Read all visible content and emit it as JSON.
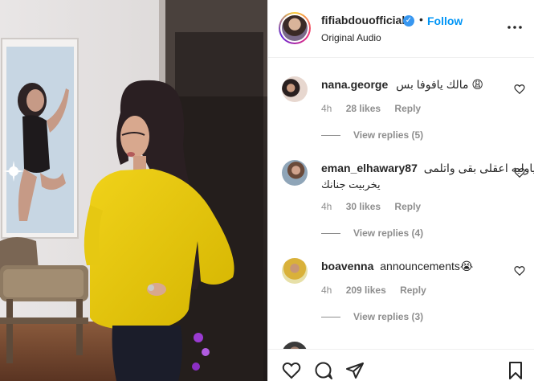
{
  "header": {
    "username": "fifiabdouofficial",
    "verified_icon": "verified-badge-icon",
    "separator": "•",
    "follow_label": "Follow",
    "subtitle": "Original Audio",
    "more_icon": "more-options-icon"
  },
  "comments": [
    {
      "username": "nana.george",
      "text": "مالك يافوفا بس 😩",
      "time": "4h",
      "likes": "28 likes",
      "reply_label": "Reply",
      "view_replies": "View replies (5)"
    },
    {
      "username": "eman_elhawary87",
      "text": "ياوليه اعقلى بقى واتلمى",
      "text_line2": "يخربيت جنانك",
      "time": "4h",
      "likes": "30 likes",
      "reply_label": "Reply",
      "view_replies": "View replies (4)"
    },
    {
      "username": "boavenna",
      "text": "announcements😭",
      "time": "4h",
      "likes": "209 likes",
      "reply_label": "Reply",
      "view_replies": "View replies (3)"
    }
  ],
  "actions": {
    "like_icon": "heart-icon",
    "comment_icon": "comment-icon",
    "share_icon": "share-icon",
    "save_icon": "bookmark-icon"
  },
  "colors": {
    "accent": "#0095f6",
    "secondary_text": "#8e8e8e",
    "primary_text": "#262626"
  }
}
